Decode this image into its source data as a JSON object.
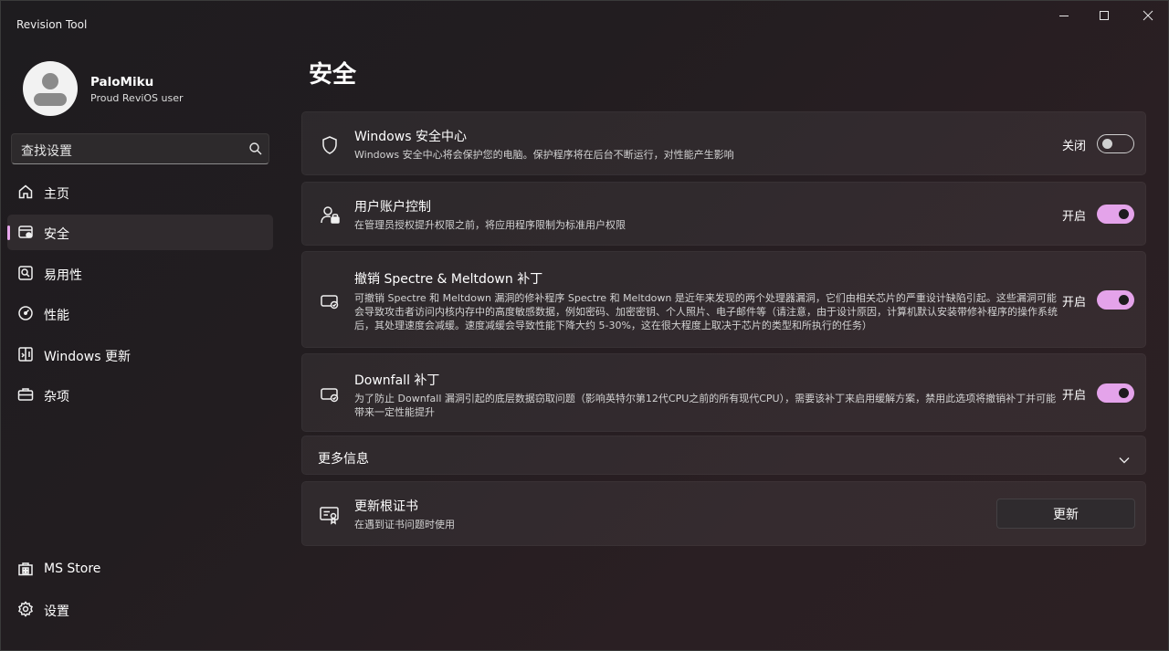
{
  "app": {
    "title": "Revision Tool"
  },
  "profile": {
    "name": "PaloMiku",
    "subtitle": "Proud ReviOS user"
  },
  "search": {
    "placeholder": "查找设置"
  },
  "nav": {
    "items": [
      {
        "label": "主页",
        "icon": "home-icon"
      },
      {
        "label": "安全",
        "icon": "security-icon",
        "active": true
      },
      {
        "label": "易用性",
        "icon": "accessibility-icon"
      },
      {
        "label": "性能",
        "icon": "performance-icon"
      },
      {
        "label": "Windows 更新",
        "icon": "windows-update-icon"
      },
      {
        "label": "杂项",
        "icon": "misc-icon"
      }
    ],
    "bottom": [
      {
        "label": "MS Store",
        "icon": "store-icon"
      },
      {
        "label": "设置",
        "icon": "settings-icon"
      }
    ]
  },
  "page": {
    "title": "安全"
  },
  "cards": [
    {
      "title": "Windows 安全中心",
      "description": "Windows 安全中心将会保护您的电脑。保护程序将在后台不断运行，对性能产生影响",
      "state_label": "关闭",
      "enabled": false
    },
    {
      "title": "用户账户控制",
      "description": "在管理员授权提升权限之前，将应用程序限制为标准用户权限",
      "state_label": "开启",
      "enabled": true
    },
    {
      "title": "撤销 Spectre & Meltdown 补丁",
      "description": "可撤销 Spectre 和 Meltdown 漏洞的修补程序 Spectre 和 Meltdown 是近年来发现的两个处理器漏洞，它们由相关芯片的严重设计缺陷引起。这些漏洞可能会导致攻击者访问内核内存中的高度敏感数据，例如密码、加密密钥、个人照片、电子邮件等（请注意，由于设计原因，计算机默认安装带修补程序的操作系统后，其处理速度会减缓。速度减缓会导致性能下降大约 5-30%，这在很大程度上取决于芯片的类型和所执行的任务）",
      "state_label": "开启",
      "enabled": true
    },
    {
      "title": "Downfall 补丁",
      "description": "为了防止 Downfall 漏洞引起的底层数据窃取问题（影响英特尔第12代CPU之前的所有现代CPU），需要该补丁来启用缓解方案，禁用此选项将撤销补丁并可能带来一定性能提升",
      "state_label": "开启",
      "enabled": true
    }
  ],
  "more_info": {
    "label": "更多信息"
  },
  "certificate": {
    "title": "更新根证书",
    "description": "在遇到证书问题时使用",
    "button_label": "更新"
  },
  "colors": {
    "accent": "#e4a3ea",
    "background": "#201c1f"
  }
}
